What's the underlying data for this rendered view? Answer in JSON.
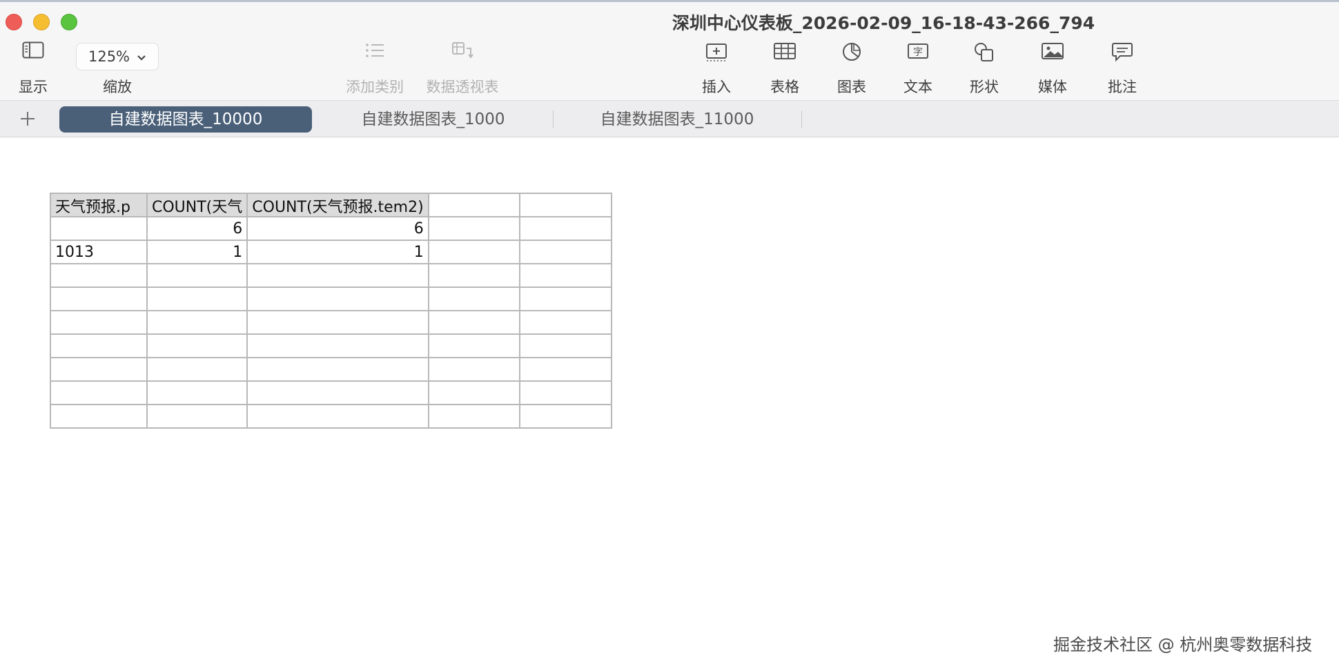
{
  "window": {
    "title": "深圳中心仪表板_2026-02-09_16-18-43-266_794"
  },
  "toolbar": {
    "view_label": "显示",
    "zoom_value": "125%",
    "zoom_label": "缩放",
    "add_category_label": "添加类别",
    "pivot_table_label": "数据透视表",
    "insert_label": "插入",
    "table_label": "表格",
    "chart_label": "图表",
    "text_label": "文本",
    "shape_label": "形状",
    "media_label": "媒体",
    "comment_label": "批注"
  },
  "tabs": [
    {
      "label": "自建数据图表_10000",
      "active": true
    },
    {
      "label": "自建数据图表_1000",
      "active": false
    },
    {
      "label": "自建数据图表_11000",
      "active": false
    }
  ],
  "table": {
    "headers": [
      "天气预报.p",
      "COUNT(天气",
      "COUNT(天气预报.tem2)",
      "",
      ""
    ],
    "rows": [
      [
        "",
        "6",
        "6",
        "",
        ""
      ],
      [
        "1013",
        "1",
        "1",
        "",
        ""
      ],
      [
        "",
        "",
        "",
        "",
        ""
      ],
      [
        "",
        "",
        "",
        "",
        ""
      ],
      [
        "",
        "",
        "",
        "",
        ""
      ],
      [
        "",
        "",
        "",
        "",
        ""
      ],
      [
        "",
        "",
        "",
        "",
        ""
      ],
      [
        "",
        "",
        "",
        "",
        ""
      ],
      [
        "",
        "",
        "",
        "",
        ""
      ]
    ]
  },
  "watermark": "掘金技术社区 @ 杭州奥零数据科技",
  "colors": {
    "active_tab": "#4a6079",
    "header_cell": "#dcdcdc",
    "grid_line": "#b8b8b8"
  }
}
